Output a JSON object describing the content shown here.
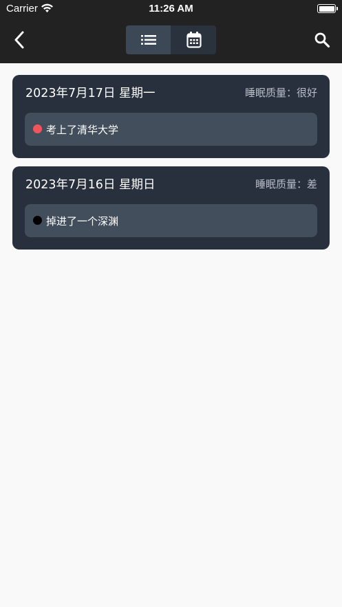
{
  "status_bar": {
    "carrier": "Carrier",
    "time": "11:26 AM"
  },
  "nav": {
    "back_icon": "chevron-left-icon",
    "view_toggle": [
      {
        "icon": "list-icon",
        "selected": true
      },
      {
        "icon": "calendar-icon",
        "selected": false
      }
    ],
    "search_icon": "search-icon"
  },
  "entries": [
    {
      "date": "2023年7月17日 星期一",
      "quality": "睡眠质量：很好",
      "dreams": [
        {
          "text": "考上了清华大学",
          "dot_color": "#f2545b"
        }
      ]
    },
    {
      "date": "2023年7月16日 星期日",
      "quality": "睡眠质量：差",
      "dreams": [
        {
          "text": "掉进了一个深渊",
          "dot_color": "#000000"
        }
      ]
    }
  ],
  "colors": {
    "header_bg": "#222222",
    "card_bg": "#27303c",
    "dream_bg": "#434e5d",
    "page_bg": "#f9f9f9"
  }
}
